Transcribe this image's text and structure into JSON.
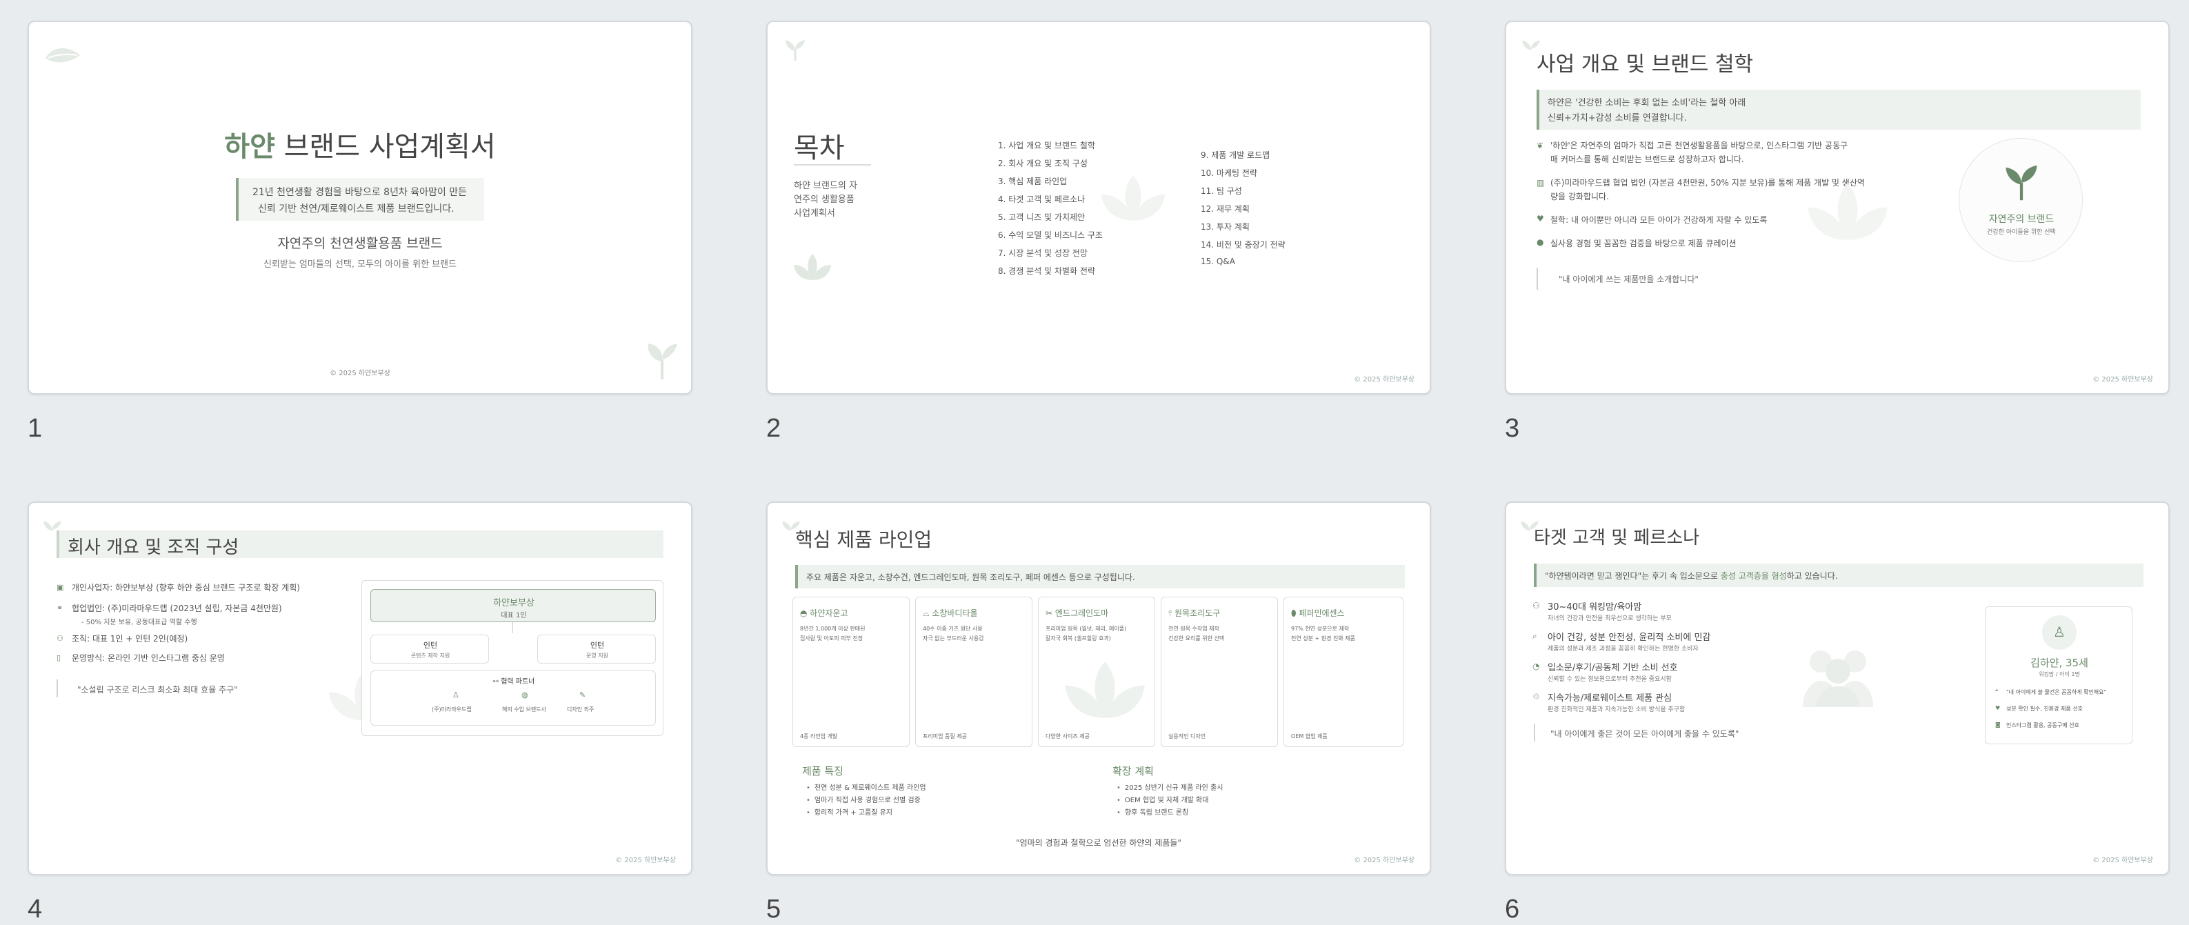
{
  "slide_numbers": [
    "1",
    "2",
    "3",
    "4",
    "5",
    "6"
  ],
  "s1": {
    "brand": "하얀",
    "title_rest": " 브랜드 사업계획서",
    "quote_l1": "21년 천연생활 경험을 바탕으로 8년차 육아맘이 만든",
    "quote_l2": "신뢰 기반 천연/제로웨이스트 제품 브랜드입니다.",
    "subtitle": "자연주의 천연생활용품 브랜드",
    "tagline": "신뢰받는 엄마들의 선택, 모두의 아이를 위한 브랜드",
    "footer": "© 2025 하얀보부상"
  },
  "s2": {
    "title": "목차",
    "desc_l1": "하얀 브랜드의 자",
    "desc_l2": "연주의 생활용품",
    "desc_l3": "사업계획서",
    "col1": [
      "1. 사업 개요 및 브랜드 철학",
      "2. 회사 개요 및 조직 구성",
      "3. 핵심 제품 라인업",
      "4. 타겟 고객 및 페르소나",
      "5. 고객 니즈 및 가치제안",
      "6. 수익 모델 및 비즈니스 구조",
      "7. 시장 분석 및 성장 전망",
      "8. 경쟁 분석 및 차별화 전략"
    ],
    "col2": [
      "9. 제품 개발 로드맵",
      "10. 마케팅 전략",
      "11. 팀 구성",
      "12. 재무 계획",
      "13. 투자 계획",
      "14. 비전 및 중장기 전략",
      "15. Q&A"
    ],
    "footer": "© 2025 하얀보부상"
  },
  "s3": {
    "title": "사업 개요 및 브랜드 철학",
    "hl_l1": "하얀은 '건강한 소비는 후회 없는 소비'라는 철학 아래",
    "hl_l2": "신뢰+가치+감성 소비를 연결합니다.",
    "b1_l1": "'하얀'은 자연주의 엄마가 직접 고른 천연생활용품을 바탕으로, 인스타그램 기반 공동구",
    "b1_l2": "매 커머스를 통해 신뢰받는 브랜드로 성장하고자 합니다.",
    "b2_l1": "(주)미라마우드랩 협업 법인 (자본금 4천만원, 50% 지분 보유)를 통해 제품 개발 및 생산역",
    "b2_l2": "량을 강화합니다.",
    "b3": "철학: 내 아이뿐만 아니라 모든 아이가 건강하게 자랄 수 있도록",
    "b4": "실사용 경험 및 꼼꼼한 검증을 바탕으로 제품 큐레이션",
    "quote": "\"내 아이에게 쓰는 제품만을 소개합니다\"",
    "badge_title": "자연주의 브랜드",
    "badge_sub": "건강한 아이들을 위한 선택",
    "footer": "© 2025 하얀보부상"
  },
  "s4": {
    "title": "회사 개요 및 조직 구성",
    "items": [
      "개인사업자: 하얀보부상 (향후 하얀 중심 브랜드 구조로 확장 계획)",
      "협업법인: (주)미라마우드랩 (2023년 설립, 자본금 4천만원)",
      "조직: 대표 1인 + 인턴 2인(예정)",
      "운영방식: 온라인 기반 인스타그램 중심 운영"
    ],
    "sub": "- 50% 지분 보유, 공동대표급 역할 수행",
    "quote": "\"소설립 구조로 리스크 최소화 최대 효율 추구\"",
    "ceo_name": "하얀보부상",
    "ceo_role": "대표 1인",
    "intern1": "인턴",
    "intern1_role": "콘텐츠 제작 지원",
    "intern2": "인턴",
    "intern2_role": "운영 지원",
    "partner_title": "협력 파트너",
    "partners": [
      "(주)미라마우드랩",
      "해외 수입 브랜드사",
      "디자인 외주"
    ],
    "footer": "© 2025 하얀보부상"
  },
  "s5": {
    "title": "핵심 제품 라인업",
    "hl": "주요 제품은 자운고, 소창수건, 엔드그레인도마, 원목 조리도구, 페퍼 에센스 등으로 구성됩니다.",
    "cards": [
      {
        "name": "하얀자운고",
        "l1": "8년간 1,000개 이상 판매된",
        "l2": "집사람 및 아토피 피부 진정",
        "foot": "4종 라인업 개발"
      },
      {
        "name": "소창바디타올",
        "l1": "40수 이중 거즈 원단 사용",
        "l2": "자극 없는 부드러운 사용감",
        "foot": "프리미엄 품질 제공"
      },
      {
        "name": "엔드그레인도마",
        "l1": "프리미엄 원목 (월넛, 체리, 메이플)",
        "l2": "칼자국 회복 (셀프힐링 효과)",
        "foot": "다양한 사이즈 제공"
      },
      {
        "name": "원목조리도구",
        "l1": "천연 원목 수작업 제작",
        "l2": "건강한 요리를 위한 선택",
        "foot": "실용적인 디자인"
      },
      {
        "name": "페퍼민에센스",
        "l1": "97% 천연 성분으로 제작",
        "l2": "천연 성분 + 환경 친화 제품",
        "foot": "OEM 협업 제품"
      }
    ],
    "feat_title": "제품 특징",
    "feat": [
      "천연 성분 & 제로웨이스트 제품 라인업",
      "엄마가 직접 사용 경험으로 선별 검증",
      "합리적 가격 + 고품질 유지"
    ],
    "exp_title": "확장 계획",
    "exp": [
      "2025 상반기 신규 제품 라인 출시",
      "OEM 협업 및 자체 개발 확대",
      "향후 독립 브랜드 론칭"
    ],
    "quote": "\"엄마의 경험과 철학으로 엄선한 하얀의 제품들\"",
    "footer": "© 2025 하얀보부상"
  },
  "s6": {
    "title": "타겟 고객 및 페르소나",
    "hl_pre": "\"하얀템이라면 믿고 쟁인다\"는 후기 속 입소문으로 ",
    "hl_em": "충성 고객층을 형성",
    "hl_post": "하고 있습니다.",
    "items": [
      {
        "t": "30~40대 워킹맘/육아맘",
        "s": "자녀의 건강과 안전을 최우선으로 생각하는 부모"
      },
      {
        "t": "아이 건강, 성분 안전성, 윤리적 소비에 민감",
        "s": "제품의 성분과 제조 과정을 꼼꼼히 확인하는 현명한 소비자"
      },
      {
        "t": "입소문/후기/공동체 기반 소비 선호",
        "s": "신뢰할 수 있는 정보원으로부터 추천을 중요시함"
      },
      {
        "t": "지속가능/제로웨이스트 제품 관심",
        "s": "환경 친화적인 제품과 지속가능한 소비 방식을 추구함"
      }
    ],
    "quote": "\"내 아이에게 좋은 것이 모든 아이에게 좋을 수 있도록\"",
    "persona_name": "김하얀, 35세",
    "persona_role": "워킹맘 / 아이 1명",
    "persona_points": [
      "\"내 아이에게 쓸 물건은 꼼꼼하게 확인해요\"",
      "성분 확인 필수, 친환경 제품 선호",
      "인스타그램 활용, 공동구매 선호"
    ],
    "footer": "© 2025 하얀보부상"
  }
}
